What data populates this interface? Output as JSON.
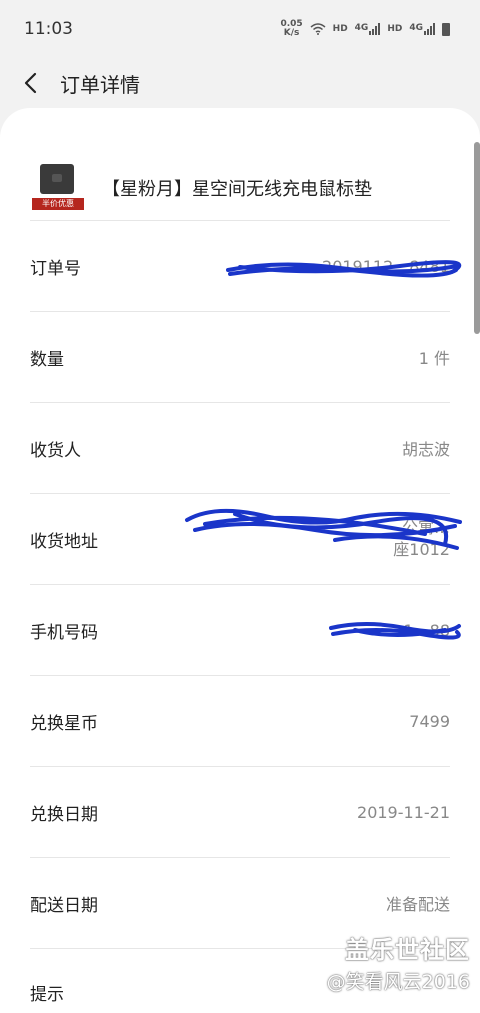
{
  "status_bar": {
    "time": "11:03",
    "net_speed_value": "0.05",
    "net_speed_unit": "K/s",
    "hd1": "HD",
    "net1": "4G",
    "hd2": "HD",
    "net2": "4G"
  },
  "header": {
    "title": "订单详情"
  },
  "product": {
    "tag": "半价优惠",
    "name": "【星粉月】星空间无线充电鼠标垫"
  },
  "rows": [
    {
      "label": "订单号",
      "value": "2019112…8481"
    },
    {
      "label": "数量",
      "value": "1 件"
    },
    {
      "label": "收货人",
      "value": "胡志波"
    },
    {
      "label": "收货地址",
      "value_line1": "公寓…",
      "value_line2": "座1012"
    },
    {
      "label": "手机号码",
      "value": "1…88"
    },
    {
      "label": "兑换星币",
      "value": "7499"
    },
    {
      "label": "兑换日期",
      "value": "2019-11-21"
    },
    {
      "label": "配送日期",
      "value": "准备配送"
    }
  ],
  "hint": "提示",
  "watermark": {
    "brand": "盖乐世社区",
    "author": "@笑看风云2016"
  },
  "colors": {
    "scribble": "#1a35c9",
    "tag": "#b5261e"
  }
}
